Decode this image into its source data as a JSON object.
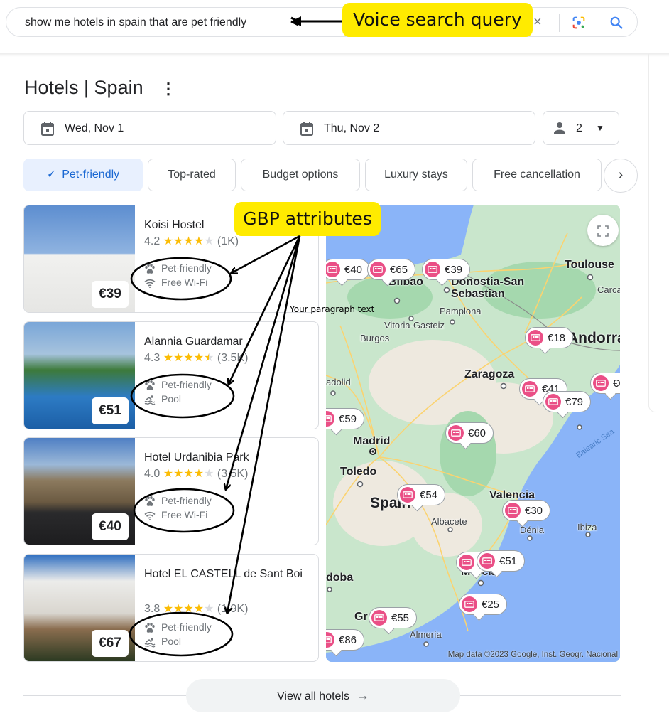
{
  "search": {
    "query": "show me hotels in spain that are pet friendly",
    "clear_icon": "close-icon",
    "lens_icon": "google-lens-icon",
    "search_icon": "search-icon"
  },
  "annotations": {
    "voice_label": "Voice search query",
    "gbp_label": "GBP attributes",
    "paragraph_placeholder": "Your paragraph text",
    "highlight_color": "#ffeb00"
  },
  "header": {
    "title": "Hotels | Spain",
    "more_icon": "⋮"
  },
  "booking": {
    "check_in": "Wed, Nov 1",
    "check_out": "Thu, Nov 2",
    "guests": "2"
  },
  "filters": {
    "chips": [
      {
        "label": "Pet-friendly",
        "active": true
      },
      {
        "label": "Top-rated",
        "active": false
      },
      {
        "label": "Budget options",
        "active": false
      },
      {
        "label": "Luxury stays",
        "active": false
      },
      {
        "label": "Free cancellation",
        "active": false
      }
    ],
    "check_mark": "✓",
    "next": "›"
  },
  "hotels": [
    {
      "name": "Koisi Hostel",
      "rating": "4.2",
      "stars": 4,
      "half": false,
      "reviews": "(1K)",
      "price": "€39",
      "amenities": [
        {
          "icon": "paw-icon",
          "label": "Pet-friendly"
        },
        {
          "icon": "wifi-icon",
          "label": "Free Wi-Fi"
        }
      ]
    },
    {
      "name": "Alannia Guardamar",
      "rating": "4.3",
      "stars": 4,
      "half": true,
      "reviews": "(3.5K)",
      "price": "€51",
      "amenities": [
        {
          "icon": "paw-icon",
          "label": "Pet-friendly"
        },
        {
          "icon": "pool-icon",
          "label": "Pool"
        }
      ]
    },
    {
      "name": "Hotel Urdanibia Park",
      "rating": "4.0",
      "stars": 4,
      "half": false,
      "reviews": "(3.5K)",
      "price": "€40",
      "amenities": [
        {
          "icon": "paw-icon",
          "label": "Pet-friendly"
        },
        {
          "icon": "wifi-icon",
          "label": "Free Wi-Fi"
        }
      ]
    },
    {
      "name": "Hotel EL CASTELL de Sant Boi",
      "rating": "3.8",
      "stars": 4,
      "half": false,
      "reviews": "(1.9K)",
      "price": "€67",
      "amenities": [
        {
          "icon": "paw-icon",
          "label": "Pet-friendly"
        },
        {
          "icon": "pool-icon",
          "label": "Pool"
        }
      ]
    }
  ],
  "map": {
    "cities": [
      "Toulouse",
      "Bilbao",
      "Donostia-San Sebastian",
      "Pamplona",
      "Vitoria-Gasteiz",
      "Burgos",
      "Andorra",
      "Carca",
      "Zaragoza",
      "adolid",
      "Madrid",
      "Toledo",
      "Spain",
      "Valencia",
      "Albacete",
      "Dénia",
      "Ibiza",
      "Murcia",
      "doba",
      "Gr",
      "Almería",
      "Balearic Sea"
    ],
    "price_pins": [
      "€40",
      "€65",
      "€39",
      "€18",
      "€41",
      "€79",
      "€6",
      "€59",
      "€60",
      "€54",
      "€30",
      "€51",
      "€25",
      "€55",
      "€86"
    ],
    "attribution": "Map data ©2023 Google, Inst. Geogr. Nacional",
    "expand_icon": "expand-icon",
    "colors": {
      "water": "#8ab4f8",
      "land": "#b5e0bf",
      "road": "#fbd370",
      "pin": "#ea4f86"
    }
  },
  "footer": {
    "view_all": "View all hotels",
    "arrow": "→"
  }
}
